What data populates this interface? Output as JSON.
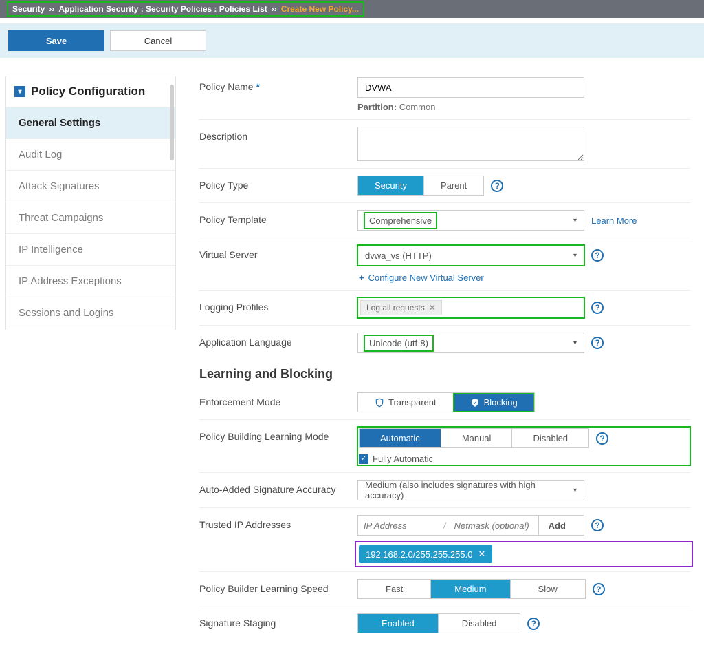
{
  "breadcrumb": {
    "root": "Security",
    "mid": "Application Security : Security Policies : Policies List",
    "active": "Create New Policy..."
  },
  "actions": {
    "save": "Save",
    "cancel": "Cancel"
  },
  "sidebar": {
    "title": "Policy Configuration",
    "items": [
      "General Settings",
      "Audit Log",
      "Attack Signatures",
      "Threat Campaigns",
      "IP Intelligence",
      "IP Address Exceptions",
      "Sessions and Logins"
    ]
  },
  "form": {
    "policy_name_label": "Policy Name",
    "policy_name_value": "DVWA",
    "partition_label": "Partition:",
    "partition_value": "Common",
    "description_label": "Description",
    "description_value": "",
    "policy_type_label": "Policy Type",
    "policy_type_options": [
      "Security",
      "Parent"
    ],
    "policy_template_label": "Policy Template",
    "policy_template_value": "Comprehensive",
    "learn_more": "Learn More",
    "virtual_server_label": "Virtual Server",
    "virtual_server_value": "dvwa_vs (HTTP)",
    "config_vs_link": "Configure New Virtual Server",
    "logging_label": "Logging Profiles",
    "logging_tag": "Log all requests",
    "app_lang_label": "Application Language",
    "app_lang_value": "Unicode (utf-8)"
  },
  "learning": {
    "heading": "Learning and Blocking",
    "enforcement_label": "Enforcement Mode",
    "enforcement_options": [
      "Transparent",
      "Blocking"
    ],
    "learning_mode_label": "Policy Building Learning Mode",
    "learning_mode_options": [
      "Automatic",
      "Manual",
      "Disabled"
    ],
    "fully_auto": "Fully Automatic",
    "sig_accuracy_label": "Auto-Added Signature Accuracy",
    "sig_accuracy_value": "Medium (also includes signatures with high accuracy)",
    "trusted_ip_label": "Trusted IP Addresses",
    "ip_placeholder": "IP Address",
    "netmask_placeholder": "Netmask (optional)",
    "add_btn": "Add",
    "ip_chip": "192.168.2.0/255.255.255.0",
    "speed_label": "Policy Builder Learning Speed",
    "speed_options": [
      "Fast",
      "Medium",
      "Slow"
    ],
    "staging_label": "Signature Staging",
    "staging_options": [
      "Enabled",
      "Disabled"
    ]
  }
}
